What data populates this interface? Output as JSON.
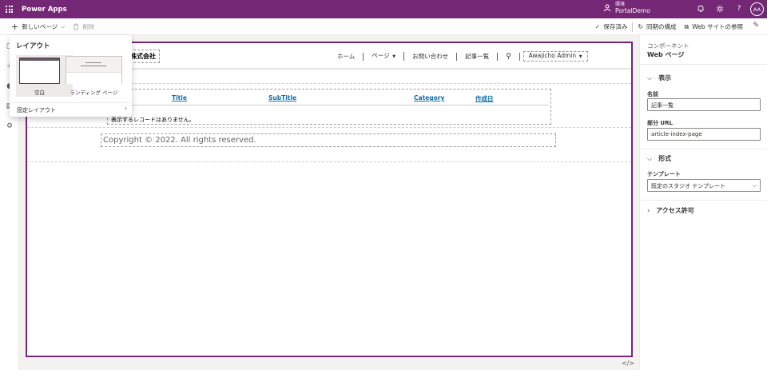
{
  "header": {
    "app_title": "Power Apps",
    "env_label": "環境",
    "env_name": "PortalDemo",
    "avatar": "AA"
  },
  "command_bar": {
    "new_page": "新しいページ",
    "delete": "削除",
    "saved": "保存済み",
    "sync": "同期の構成",
    "browse": "Web サイトの参照"
  },
  "flyout": {
    "title": "レイアウト",
    "tiles": [
      "空白",
      "ランディング ページ"
    ],
    "fixed_layout": "固定レイアウト"
  },
  "site": {
    "brand": "ーソ株式会社",
    "nav": [
      "ホーム",
      "ページ",
      "お問い合わせ",
      "記事一覧"
    ],
    "user": "Awajicho Admin",
    "columns": [
      "Title",
      "SubTitle",
      "Category",
      "作成日"
    ],
    "empty": "表示するレコードはありません。",
    "footer": "Copyright © 2022. All rights reserved."
  },
  "panel": {
    "subtitle": "コンポーネント",
    "title": "Web ページ",
    "section_display": "表示",
    "name_label": "名前",
    "name_value": "記事一覧",
    "url_label": "部分 URL",
    "url_value": "article-index-page",
    "section_format": "形式",
    "template_label": "テンプレート",
    "template_value": "既定のスタジオ テンプレート",
    "section_access": "アクセス許可"
  },
  "colors": {
    "brand_purple": "#742774",
    "link_blue": "#0f6cbd"
  },
  "icons": [
    "waffle-icon",
    "environment-icon",
    "bell-icon",
    "gear-icon",
    "help-icon",
    "plus-icon",
    "trash-icon",
    "check-icon",
    "sync-icon",
    "external-link-icon",
    "search-icon",
    "code-icon"
  ]
}
